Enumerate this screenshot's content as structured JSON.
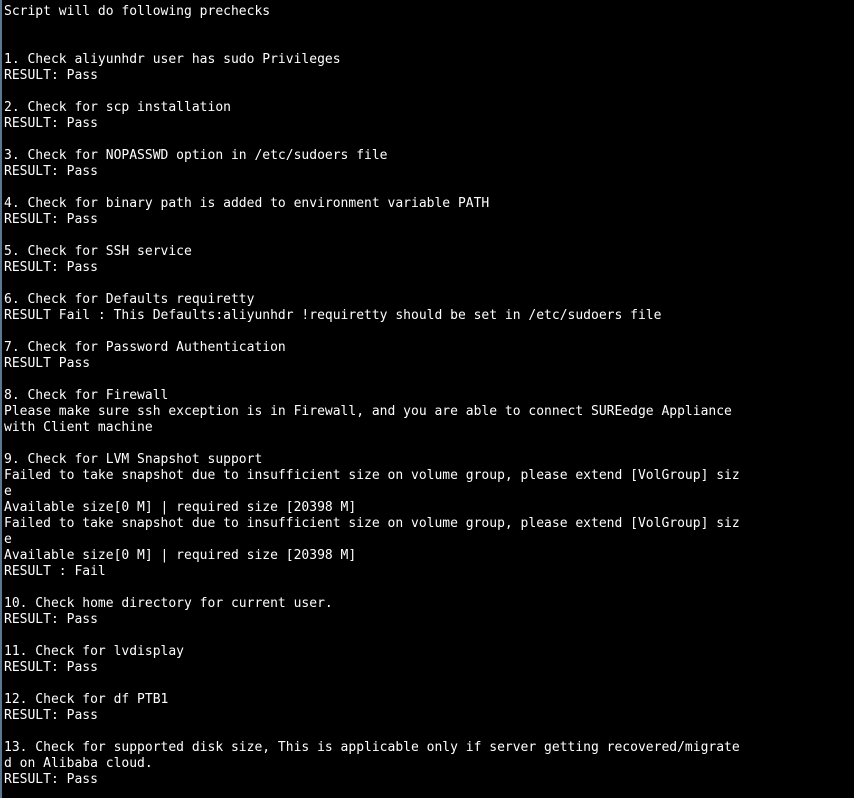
{
  "window": {
    "type": "terminal",
    "background_color": "#000000",
    "foreground_color": "#ffffff",
    "left_border_color": "#5b7794",
    "columns": 103,
    "rows": 50
  },
  "terminal": {
    "header": "Script will do following prechecks",
    "lines": [
      "Script will do following prechecks",
      "",
      "",
      "1. Check aliyunhdr user has sudo Privileges",
      "RESULT: Pass",
      "",
      "2. Check for scp installation",
      "RESULT: Pass",
      "",
      "3. Check for NOPASSWD option in /etc/sudoers file",
      "RESULT: Pass",
      "",
      "4. Check for binary path is added to environment variable PATH",
      "RESULT: Pass",
      "",
      "5. Check for SSH service",
      "RESULT: Pass",
      "",
      "6. Check for Defaults requiretty",
      "RESULT Fail : This Defaults:aliyunhdr !requiretty should be set in /etc/sudoers file",
      "",
      "7. Check for Password Authentication",
      "RESULT Pass",
      "",
      "8. Check for Firewall",
      "Please make sure ssh exception is in Firewall, and you are able to connect SUREedge Appliance",
      "with Client machine",
      "",
      "9. Check for LVM Snapshot support",
      "Failed to take snapshot due to insufficient size on volume group, please extend [VolGroup] siz",
      "e",
      "Available size[0 M] | required size [20398 M]",
      "Failed to take snapshot due to insufficient size on volume group, please extend [VolGroup] siz",
      "e",
      "Available size[0 M] | required size [20398 M]",
      "RESULT : Fail",
      "",
      "10. Check home directory for current user.",
      "RESULT: Pass",
      "",
      "11. Check for lvdisplay",
      "RESULT: Pass",
      "",
      "12. Check for df PTB1",
      "RESULT: Pass",
      "",
      "13. Check for supported disk size, This is applicable only if server getting recovered/migrate",
      "d on Alibaba cloud.",
      "RESULT: Pass"
    ],
    "checks": [
      {
        "number": "1",
        "title": "Check aliyunhdr user has sudo Privileges",
        "result": "RESULT: Pass",
        "status": "Pass"
      },
      {
        "number": "2",
        "title": "Check for scp installation",
        "result": "RESULT: Pass",
        "status": "Pass"
      },
      {
        "number": "3",
        "title": "Check for NOPASSWD option in /etc/sudoers file",
        "result": "RESULT: Pass",
        "status": "Pass"
      },
      {
        "number": "4",
        "title": "Check for binary path is added to environment variable PATH",
        "result": "RESULT: Pass",
        "status": "Pass"
      },
      {
        "number": "5",
        "title": "Check for SSH service",
        "result": "RESULT: Pass",
        "status": "Pass"
      },
      {
        "number": "6",
        "title": "Check for Defaults requiretty",
        "result": "RESULT Fail : This Defaults:aliyunhdr !requiretty should be set in /etc/sudoers file",
        "status": "Fail"
      },
      {
        "number": "7",
        "title": "Check for Password Authentication",
        "result": "RESULT Pass",
        "status": "Pass"
      },
      {
        "number": "8",
        "title": "Check for Firewall",
        "result": "Please make sure ssh exception is in Firewall, and you are able to connect SUREedge Appliance with Client machine",
        "status": "Info"
      },
      {
        "number": "9",
        "title": "Check for LVM Snapshot support",
        "result": "RESULT : Fail",
        "status": "Fail",
        "details": [
          "Failed to take snapshot due to insufficient size on volume group, please extend [VolGroup] size",
          "Available size[0 M] | required size [20398 M]",
          "Failed to take snapshot due to insufficient size on volume group, please extend [VolGroup] size",
          "Available size[0 M] | required size [20398 M]"
        ],
        "available_size": "0 M",
        "required_size": "20398 M",
        "volume_group": "VolGroup"
      },
      {
        "number": "10",
        "title": "Check home directory for current user.",
        "result": "RESULT: Pass",
        "status": "Pass"
      },
      {
        "number": "11",
        "title": "Check for lvdisplay",
        "result": "RESULT: Pass",
        "status": "Pass"
      },
      {
        "number": "12",
        "title": "Check for df PTB1",
        "result": "RESULT: Pass",
        "status": "Pass"
      },
      {
        "number": "13",
        "title": "Check for supported disk size, This is applicable only if server getting recovered/migrated on Alibaba cloud.",
        "result": "RESULT: Pass",
        "status": "Pass"
      }
    ]
  }
}
